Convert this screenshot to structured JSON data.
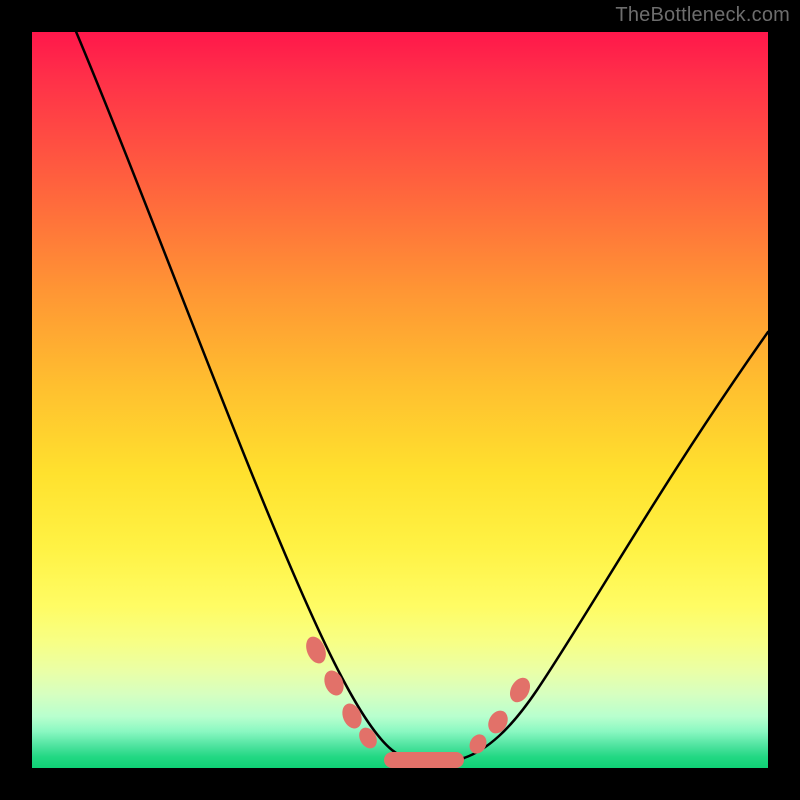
{
  "watermark": "TheBottleneck.com",
  "colors": {
    "frame": "#000000",
    "gradient_top": "#ff174b",
    "gradient_mid1": "#ff9534",
    "gradient_mid2": "#fff244",
    "gradient_bottom": "#0fd175",
    "curve": "#000000",
    "markers": "#e27169",
    "watermark": "#6d6d6d"
  },
  "chart_data": {
    "type": "line",
    "title": "",
    "xlabel": "",
    "ylabel": "",
    "xlim": [
      0,
      100
    ],
    "ylim": [
      0,
      100
    ],
    "series": [
      {
        "name": "bottleneck-curve",
        "x": [
          5,
          10,
          15,
          20,
          25,
          30,
          35,
          40,
          42,
          45,
          47,
          50,
          53,
          55,
          58,
          62,
          65,
          70,
          75,
          80,
          85,
          90,
          95,
          100
        ],
        "values": [
          100,
          90,
          79,
          67,
          55,
          43,
          31,
          18,
          12,
          6,
          3,
          1,
          1,
          1,
          2,
          4,
          7,
          13,
          21,
          29,
          37,
          45,
          52,
          59
        ]
      }
    ],
    "markers": [
      {
        "x": 38.3,
        "y": 14.3
      },
      {
        "x": 40.5,
        "y": 9.8
      },
      {
        "x": 43.0,
        "y": 5.0
      },
      {
        "x": 45.0,
        "y": 2.8
      },
      {
        "x": 49.0,
        "y": 1.0
      },
      {
        "x": 52.0,
        "y": 0.9
      },
      {
        "x": 55.5,
        "y": 1.5
      },
      {
        "x": 58.0,
        "y": 2.4
      },
      {
        "x": 62.5,
        "y": 5.3
      },
      {
        "x": 65.5,
        "y": 8.6
      }
    ],
    "notes": "V-shaped bottleneck curve on a red-to-green vertical gradient; minimum near x≈50."
  }
}
